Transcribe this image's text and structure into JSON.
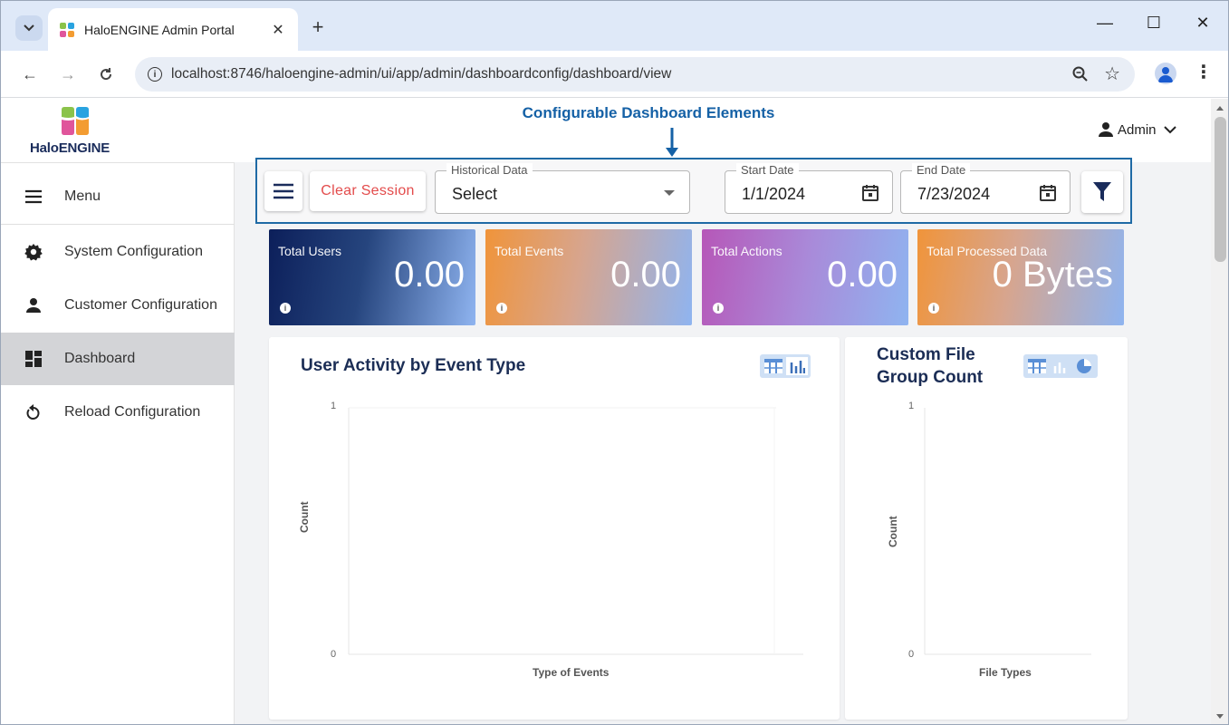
{
  "browser": {
    "tab_title": "HaloENGINE Admin Portal",
    "url": "localhost:8746/haloengine-admin/ui/app/admin/dashboardconfig/dashboard/view"
  },
  "header": {
    "brand": "HaloENGINE",
    "annotation": "Configurable Dashboard Elements",
    "user": "Admin"
  },
  "sidebar": {
    "items": [
      {
        "label": "Menu",
        "icon": "hamburger-icon"
      },
      {
        "label": "System Configuration",
        "icon": "gear-icon"
      },
      {
        "label": "Customer Configuration",
        "icon": "person-icon"
      },
      {
        "label": "Dashboard",
        "icon": "dashboard-icon"
      },
      {
        "label": "Reload Configuration",
        "icon": "reload-icon"
      }
    ],
    "active": "Dashboard"
  },
  "filters": {
    "clear_label": "Clear Session",
    "historical_label": "Historical Data",
    "historical_value": "Select",
    "start_label": "Start Date",
    "start_value": "1/1/2024",
    "end_label": "End Date",
    "end_value": "7/23/2024"
  },
  "stats": [
    {
      "label": "Total Users",
      "value": "0.00"
    },
    {
      "label": "Total Events",
      "value": "0.00"
    },
    {
      "label": "Total Actions",
      "value": "0.00"
    },
    {
      "label": "Total Processed Data",
      "value": "0 Bytes"
    }
  ],
  "charts": {
    "activity": {
      "title": "User Activity by Event Type",
      "ylabel": "Count",
      "xlabel": "Type of Events",
      "ymax": "1",
      "ymin": "0"
    },
    "filegroup": {
      "title_line1": "Custom File",
      "title_line2": "Group Count",
      "ylabel": "Count",
      "xlabel": "File Types",
      "ymax": "1",
      "ymin": "0"
    }
  },
  "colors": {
    "accent": "#1561a6",
    "clear": "#e34b4b",
    "brand_navy": "#1a2c5b"
  }
}
